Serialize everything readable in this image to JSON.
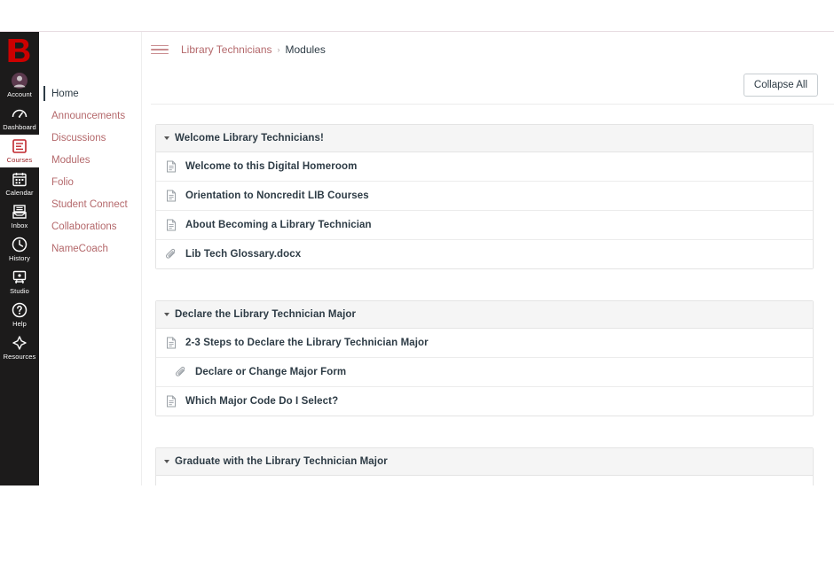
{
  "global_nav": {
    "logo_name": "butte-college-b-logo",
    "items": [
      {
        "label": "Account",
        "icon": "account-avatar-icon",
        "active": false
      },
      {
        "label": "Dashboard",
        "icon": "dashboard-gauge-icon",
        "active": false
      },
      {
        "label": "Courses",
        "icon": "courses-book-icon",
        "active": true
      },
      {
        "label": "Calendar",
        "icon": "calendar-icon",
        "active": false
      },
      {
        "label": "Inbox",
        "icon": "inbox-tray-icon",
        "active": false
      },
      {
        "label": "History",
        "icon": "history-clock-icon",
        "active": false
      },
      {
        "label": "Studio",
        "icon": "studio-screen-icon",
        "active": false
      },
      {
        "label": "Help",
        "icon": "help-question-icon",
        "active": false
      },
      {
        "label": "Resources",
        "icon": "resources-pin-icon",
        "active": false
      }
    ]
  },
  "course_nav": {
    "items": [
      {
        "label": "Home",
        "active": true
      },
      {
        "label": "Announcements",
        "active": false
      },
      {
        "label": "Discussions",
        "active": false
      },
      {
        "label": "Modules",
        "active": false
      },
      {
        "label": "Folio",
        "active": false
      },
      {
        "label": "Student Connect",
        "active": false
      },
      {
        "label": "Collaborations",
        "active": false
      },
      {
        "label": "NameCoach",
        "active": false
      }
    ]
  },
  "header": {
    "menu_icon": "hamburger-menu-icon",
    "breadcrumb": {
      "course": "Library Technicians",
      "separator": "›",
      "current": "Modules"
    }
  },
  "toolbar": {
    "collapse_all_label": "Collapse All"
  },
  "modules": [
    {
      "title": "Welcome Library Technicians!",
      "collapse_icon": "triangle-down-icon",
      "items": [
        {
          "title": "Welcome to this Digital Homeroom",
          "icon": "page-document-icon",
          "indent": false
        },
        {
          "title": "Orientation to Noncredit LIB Courses",
          "icon": "page-document-icon",
          "indent": false
        },
        {
          "title": "About Becoming a Library Technician",
          "icon": "page-document-icon",
          "indent": false
        },
        {
          "title": "Lib Tech Glossary.docx",
          "icon": "paperclip-attachment-icon",
          "indent": false
        }
      ]
    },
    {
      "title": "Declare the Library Technician Major",
      "collapse_icon": "triangle-down-icon",
      "items": [
        {
          "title": "2-3 Steps to Declare the Library Technician Major",
          "icon": "page-document-icon",
          "indent": false
        },
        {
          "title": "Declare or Change Major Form",
          "icon": "paperclip-attachment-icon",
          "indent": true
        },
        {
          "title": "Which Major Code Do I Select?",
          "icon": "page-document-icon",
          "indent": false
        }
      ]
    },
    {
      "title": "Graduate with the Library Technician Major",
      "collapse_icon": "triangle-down-icon",
      "items": []
    }
  ],
  "colors": {
    "global_nav_bg": "#1c1b1b",
    "brand_red": "#c0272d",
    "link_red": "#b4686b",
    "text_dark": "#2d3b45",
    "module_header_bg": "#f5f5f5",
    "border_gray": "#e4e4e4"
  }
}
